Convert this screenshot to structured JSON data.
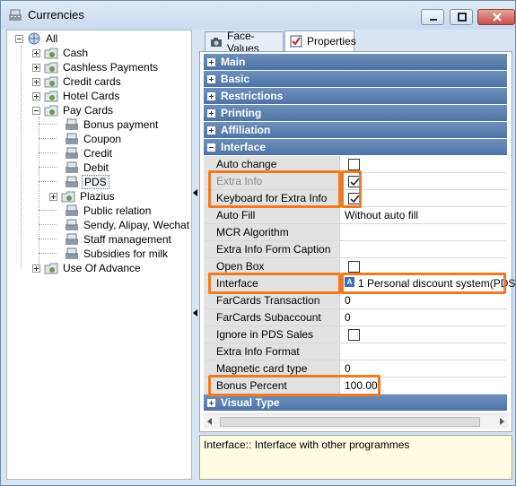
{
  "window": {
    "title": "Currencies"
  },
  "tree": {
    "root": "All",
    "items": [
      {
        "label": "Cash"
      },
      {
        "label": "Cashless Payments"
      },
      {
        "label": "Credit cards"
      },
      {
        "label": "Hotel Cards"
      },
      {
        "label": "Pay Cards"
      },
      {
        "label": "Bonus payment"
      },
      {
        "label": "Coupon"
      },
      {
        "label": "Credit"
      },
      {
        "label": "Debit"
      },
      {
        "label": "PDS"
      },
      {
        "label": "Plazius"
      },
      {
        "label": "Public relation"
      },
      {
        "label": "Sendy, Alipay, Wechat"
      },
      {
        "label": "Staff management"
      },
      {
        "label": "Subsidies for milk"
      },
      {
        "label": "Use Of Advance"
      }
    ]
  },
  "tabs": [
    {
      "label": "Face-Values"
    },
    {
      "label": "Properties"
    }
  ],
  "categories": {
    "main": "Main",
    "basic": "Basic",
    "restrictions": "Restrictions",
    "printing": "Printing",
    "affiliation": "Affiliation",
    "interface": "Interface",
    "visual_type": "Visual Type"
  },
  "properties": [
    {
      "name": "Auto change",
      "value": "",
      "checkbox": "unchecked"
    },
    {
      "name": "Extra Info",
      "value": "",
      "checkbox": "checked",
      "disabled": true
    },
    {
      "name": "Keyboard for Extra Info",
      "value": "",
      "checkbox": "checked"
    },
    {
      "name": "Auto Fill",
      "value": "Without auto fill"
    },
    {
      "name": "MCR Algorithm",
      "value": ""
    },
    {
      "name": "Extra Info Form Caption",
      "value": ""
    },
    {
      "name": "Open Box",
      "value": "",
      "checkbox": "unchecked"
    },
    {
      "name": "Interface",
      "value": "1 Personal discount system(PDS)",
      "value_icon": "A"
    },
    {
      "name": "FarCards Transaction",
      "value": "0"
    },
    {
      "name": "FarCards Subaccount",
      "value": "0"
    },
    {
      "name": "Ignore in PDS Sales",
      "value": "",
      "checkbox": "unchecked"
    },
    {
      "name": "Extra Info Format",
      "value": ""
    },
    {
      "name": "Magnetic card type",
      "value": "0"
    },
    {
      "name": "Bonus Percent",
      "value": "100.00"
    }
  ],
  "description": "Interface:: Interface with other programmes",
  "colors": {
    "highlight": "#f07a22",
    "category_bar": "#5b7fb0",
    "description_bg": "#fffce1"
  }
}
